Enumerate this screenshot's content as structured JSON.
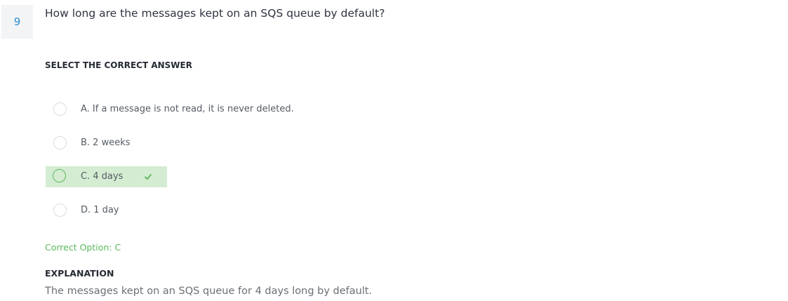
{
  "question": {
    "number": "9",
    "text": "How long are the messages kept on an SQS queue by default?"
  },
  "instruction": "SELECT THE CORRECT ANSWER",
  "options": [
    {
      "label": "A. If a message is not read, it is never deleted.",
      "is_correct": false
    },
    {
      "label": "B. 2 weeks",
      "is_correct": false
    },
    {
      "label": "C. 4 days",
      "is_correct": true
    },
    {
      "label": "D. 1 day",
      "is_correct": false
    }
  ],
  "correct_option_text": "Correct Option: C",
  "explanation": {
    "title": "EXPLANATION",
    "text": "The messages kept on an SQS queue for 4 days long by default."
  },
  "colors": {
    "accent_blue": "#2b8fcb",
    "correct_green": "#5cb85c",
    "correct_bg": "#d4ecd2"
  }
}
